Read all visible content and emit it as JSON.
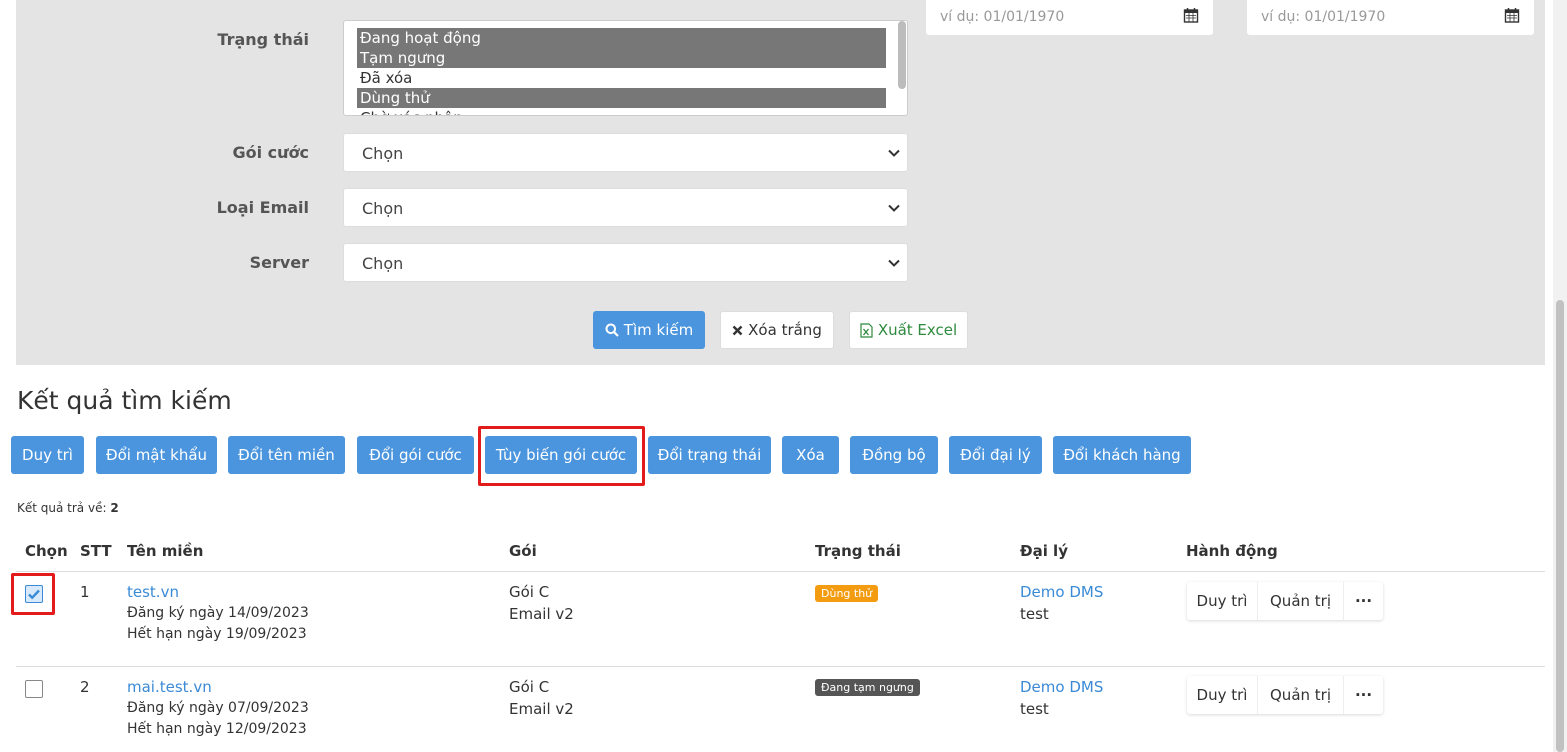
{
  "filters": {
    "status_label": "Trạng thái",
    "status_options": [
      "Đang hoạt động",
      "Tạm ngưng",
      "Đã xóa",
      "Dùng thử",
      "Chờ xác nhận"
    ],
    "package_label": "Gói cước",
    "package_value": "Chọn",
    "email_type_label": "Loại Email",
    "email_type_value": "Chọn",
    "server_label": "Server",
    "server_value": "Chọn",
    "date_from_placeholder": "ví dụ: 01/01/1970",
    "date_to_placeholder": "ví dụ: 01/01/1970",
    "search_button": "Tìm kiếm",
    "clear_button": "Xóa trắng",
    "export_button": "Xuất Excel"
  },
  "results": {
    "title": "Kết quả tìm kiếm",
    "count_label": "Kết quả trả về:",
    "count": "2",
    "actions": [
      "Duy trì",
      "Đổi mật khẩu",
      "Đổi tên miền",
      "Đổi gói cước",
      "Tùy biến gói cước",
      "Đổi trạng thái",
      "Xóa",
      "Đồng bộ",
      "Đổi đại lý",
      "Đổi khách hàng"
    ],
    "columns": [
      "Chọn",
      "STT",
      "Tên miền",
      "Gói",
      "Trạng thái",
      "Đại lý",
      "Hành động"
    ],
    "rows": [
      {
        "checked": true,
        "stt": "1",
        "domain": "test.vn",
        "registered": "Đăng ký ngày 14/09/2023",
        "expires": "Hết hạn ngày 19/09/2023",
        "package": "Gói C",
        "email": "Email v2",
        "status": "Dùng thử",
        "status_color": "#f39c12",
        "agent": "Demo DMS",
        "customer": "test",
        "btn_maintain": "Duy trì",
        "btn_admin": "Quản trị",
        "btn_more": "···"
      },
      {
        "checked": false,
        "stt": "2",
        "domain": "mai.test.vn",
        "registered": "Đăng ký ngày 07/09/2023",
        "expires": "Hết hạn ngày 12/09/2023",
        "package": "Gói C",
        "email": "Email v2",
        "status": "Đang tạm ngưng",
        "status_color": "#555555",
        "agent": "Demo DMS",
        "customer": "test",
        "btn_maintain": "Duy trì",
        "btn_admin": "Quản trị",
        "btn_more": "···"
      }
    ]
  },
  "colors": {
    "primary": "#4a95de",
    "highlight": "#e31b1b",
    "panel": "#e4e4e4"
  }
}
